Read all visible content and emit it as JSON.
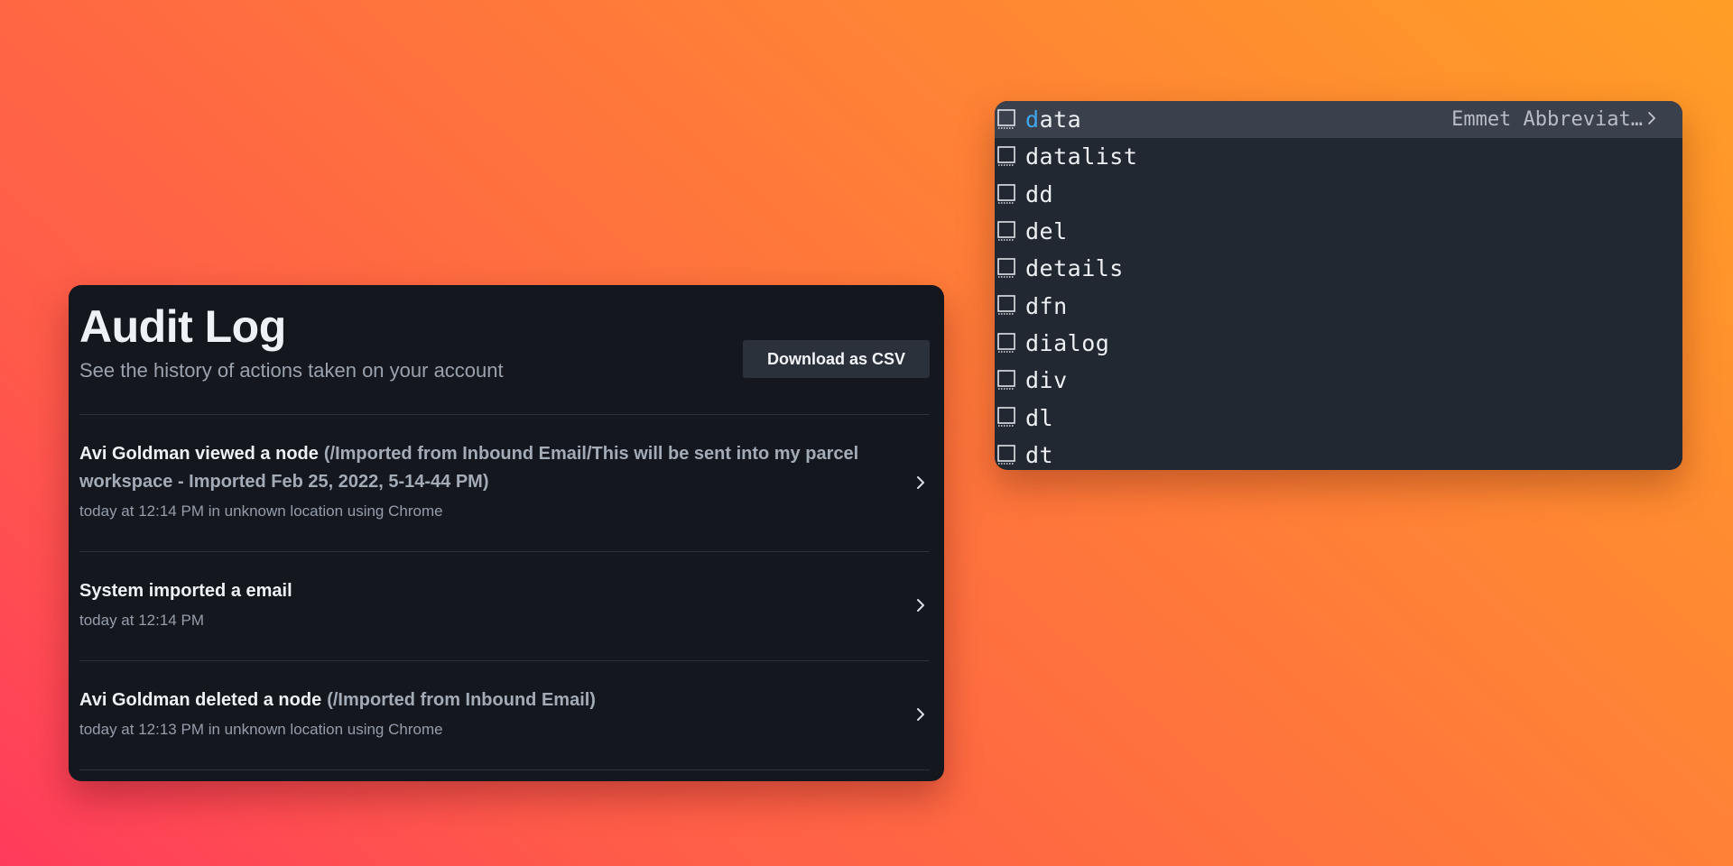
{
  "audit_log": {
    "title": "Audit Log",
    "subtitle": "See the history of actions taken on your account",
    "download_button": "Download as CSV",
    "entries": [
      {
        "action": "Avi Goldman viewed a node",
        "detail": "(/Imported from Inbound Email/This will be sent into my parcel workspace - Imported Feb 25, 2022, 5-14-44 PM)",
        "meta": "today at 12:14 PM in unknown location using Chrome"
      },
      {
        "action": "System imported a email",
        "detail": "",
        "meta": "today at 12:14 PM"
      },
      {
        "action": "Avi Goldman deleted a node",
        "detail": "(/Imported from Inbound Email)",
        "meta": "today at 12:13 PM in unknown location using Chrome"
      }
    ],
    "row_icon": "chevron-right-icon"
  },
  "autocomplete": {
    "typed_prefix": "d",
    "item_icon": "snippet-square-icon",
    "selected_detail": "Emmet Abbreviat…",
    "details_icon": "chevron-right-icon",
    "items": [
      {
        "prefix": "d",
        "rest": "ata"
      },
      {
        "prefix": "",
        "rest": "datalist"
      },
      {
        "prefix": "",
        "rest": "dd"
      },
      {
        "prefix": "",
        "rest": "del"
      },
      {
        "prefix": "",
        "rest": "details"
      },
      {
        "prefix": "",
        "rest": "dfn"
      },
      {
        "prefix": "",
        "rest": "dialog"
      },
      {
        "prefix": "",
        "rest": "div"
      },
      {
        "prefix": "",
        "rest": "dl"
      },
      {
        "prefix": "",
        "rest": "dt"
      }
    ],
    "colors": {
      "highlight": "#3ea6ef",
      "selected_row": "#3b414c",
      "background": "#222831"
    }
  }
}
